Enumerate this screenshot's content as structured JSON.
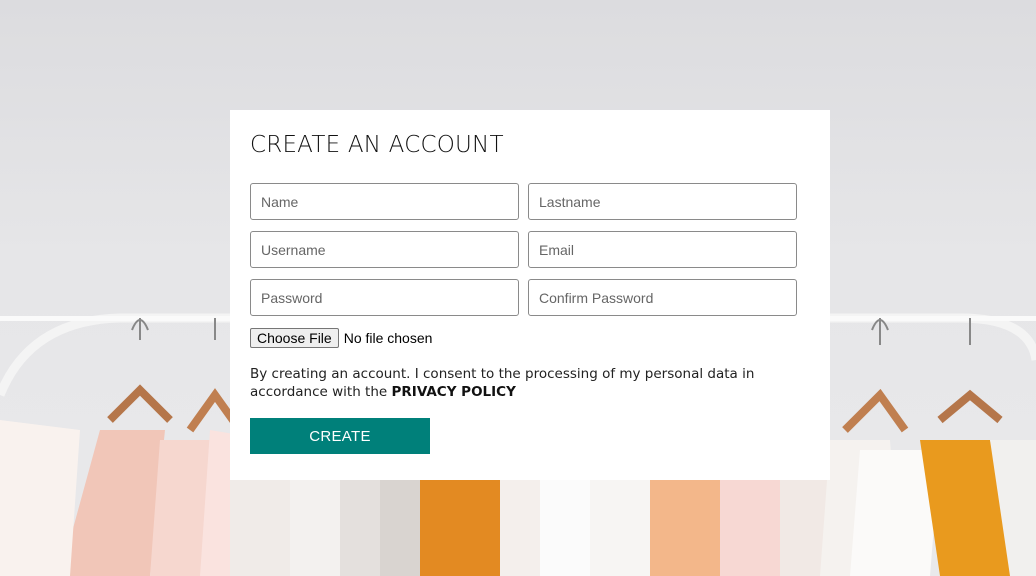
{
  "form": {
    "title": "CREATE AN ACCOUNT",
    "fields": {
      "name": {
        "placeholder": "Name",
        "value": ""
      },
      "lastname": {
        "placeholder": "Lastname",
        "value": ""
      },
      "username": {
        "placeholder": "Username",
        "value": ""
      },
      "email": {
        "placeholder": "Email",
        "value": ""
      },
      "password": {
        "placeholder": "Password",
        "value": ""
      },
      "confirm_password": {
        "placeholder": "Confirm Password",
        "value": ""
      }
    },
    "file_upload": {
      "button_label": "Choose File",
      "status": "No file chosen"
    },
    "consent_text": "By creating an account. I consent to the processing of my personal data in accordance with the ",
    "privacy_policy_label": "PRIVACY POLICY",
    "submit_label": "CREATE"
  },
  "colors": {
    "accent": "#00807a",
    "card_background": "#ffffff",
    "page_background": "#e4e4e6"
  },
  "background_image": "clothing-rack-photo"
}
